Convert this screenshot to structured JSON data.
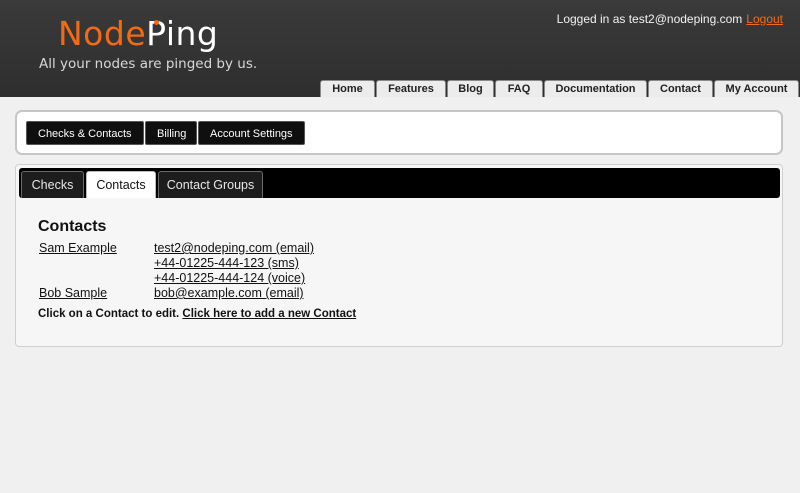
{
  "header": {
    "logo_node": "Node",
    "logo_ping": "Ping",
    "tagline": "All your nodes are pinged by us.",
    "logged_in_text": "Logged in as test2@nodeping.com",
    "logout_label": "Logout",
    "nav": [
      "Home",
      "Features",
      "Blog",
      "FAQ",
      "Documentation",
      "Contact",
      "My Account"
    ]
  },
  "subnav": {
    "buttons": [
      "Checks & Contacts",
      "Billing",
      "Account Settings"
    ]
  },
  "tabs": {
    "items": [
      "Checks",
      "Contacts",
      "Contact Groups"
    ],
    "active": "Contacts"
  },
  "contacts": {
    "title": "Contacts",
    "list": [
      {
        "name": "Sam Example",
        "methods": [
          "test2@nodeping.com (email)",
          "+44-01225-444-123 (sms)",
          "+44-01225-444-124 (voice)"
        ]
      },
      {
        "name": "Bob Sample",
        "methods": [
          "bob@example.com (email)"
        ]
      }
    ],
    "instruction": "Click on a Contact to edit.",
    "add_link": "Click here to add a new Contact"
  },
  "colors": {
    "brand_orange": "#f26a14",
    "header_bg": "#333333",
    "tab_bar": "#000000"
  }
}
